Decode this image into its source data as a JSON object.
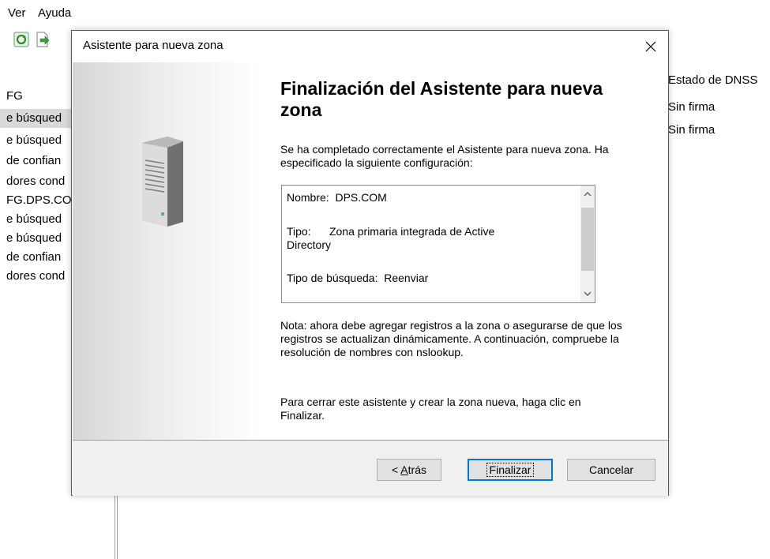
{
  "menubar": {
    "ver": "Ver",
    "ayuda": "Ayuda"
  },
  "tree": {
    "items": [
      "FG",
      "e búsqued",
      "e búsqued",
      "de confian",
      "dores cond",
      "FG.DPS.CO",
      "e búsqued",
      "e búsqued",
      "de confian",
      "dores cond"
    ]
  },
  "right_pane": {
    "column_header": "Estado de DNSS",
    "rows": [
      "Sin firma",
      "Sin firma"
    ]
  },
  "dialog": {
    "title": "Asistente para nueva zona",
    "heading": "Finalización del Asistente para nueva zona",
    "intro": "Se ha completado correctamente el Asistente para nueva zona. Ha especificado la siguiente configuración:",
    "summary": {
      "nombre": "Nombre:  DPS.COM",
      "tipo_line1": "Tipo:      Zona primaria integrada de Active",
      "tipo_line2": "Directory",
      "busqueda": "Tipo de búsqueda:  Reenviar"
    },
    "note": "Nota: ahora debe agregar registros a la zona o asegurarse de que los registros se actualizan dinámicamente. A continuación, compruebe la resolución de nombres con nslookup.",
    "closing": "Para cerrar este asistente y crear la zona nueva, haga clic en Finalizar.",
    "buttons": {
      "back_prefix": "< ",
      "back_accel": "A",
      "back_rest": "trás",
      "finish": "Finalizar",
      "cancel": "Cancelar"
    }
  },
  "colors": {
    "accent": "#0078d7",
    "footer": "#f0f0f0",
    "selection": "#d9d9d9"
  },
  "icons": [
    "refresh-icon",
    "export-icon",
    "server-icon",
    "close-icon",
    "scroll-up-icon",
    "scroll-down-icon"
  ]
}
